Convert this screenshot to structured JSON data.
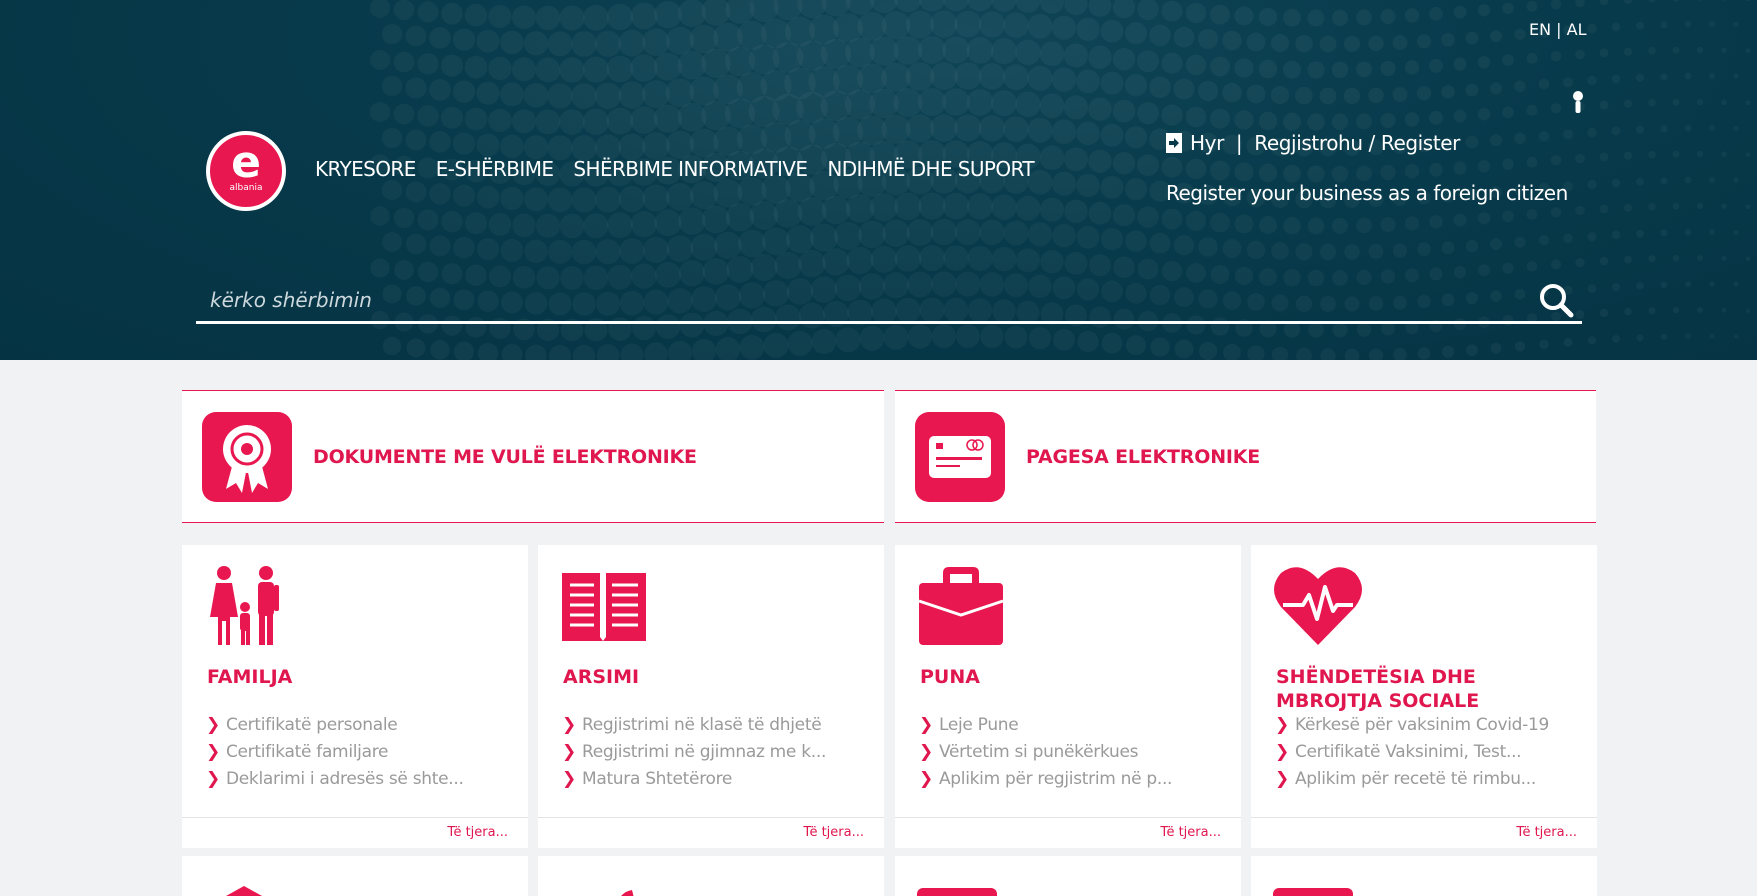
{
  "header": {
    "lang": {
      "en": "EN",
      "sep": "|",
      "al": "AL"
    },
    "logo": {
      "letter": "e",
      "text": "albania"
    },
    "nav": [
      "KRYESORE",
      "E-SHËRBIME",
      "SHËRBIME INFORMATIVE",
      "NDIHMË DHE SUPORT"
    ],
    "login_label": "Hyr",
    "auth_sep": "|",
    "register_label": "Regjistrohu / Register",
    "foreign_link": "Register your business as a foreign citizen"
  },
  "search": {
    "placeholder": "kërko shërbimin"
  },
  "banners": [
    {
      "title": "DOKUMENTE ME VULË ELEKTRONIKE",
      "icon": "award-ribbon-icon"
    },
    {
      "title": "PAGESA ELEKTRONIKE",
      "icon": "credit-card-icon"
    }
  ],
  "categories": [
    {
      "title": "FAMILJA",
      "icon": "family-icon",
      "items": [
        "Certifikatë personale",
        "Certifikatë familjare",
        "Deklarimi i adresës së shte..."
      ],
      "more": "Të tjera..."
    },
    {
      "title": "ARSIMI",
      "icon": "open-book-icon",
      "items": [
        "Regjistrimi në klasë të dhjetë",
        "Regjistrimi në gjimnaz me k...",
        "Matura Shtetërore"
      ],
      "more": "Të tjera..."
    },
    {
      "title": "PUNA",
      "icon": "briefcase-icon",
      "items": [
        "Leje Pune",
        "Vërtetim si punëkërkues",
        "Aplikim për regjistrim në p..."
      ],
      "more": "Të tjera..."
    },
    {
      "title": "SHËNDETËSIA DHE MBROJTJA SOCIALE",
      "icon": "heart-pulse-icon",
      "items": [
        "Kërkesë për vaksinim Covid-19",
        "Certifikatë Vaksinimi, Test...",
        "Aplikim për recetë të rimbu..."
      ],
      "more": "Të tjera..."
    }
  ],
  "card_chevron": "❯",
  "colors": {
    "accent": "#e8174f",
    "header_bg": "#073a4b",
    "page_bg": "#f0f2f3"
  }
}
